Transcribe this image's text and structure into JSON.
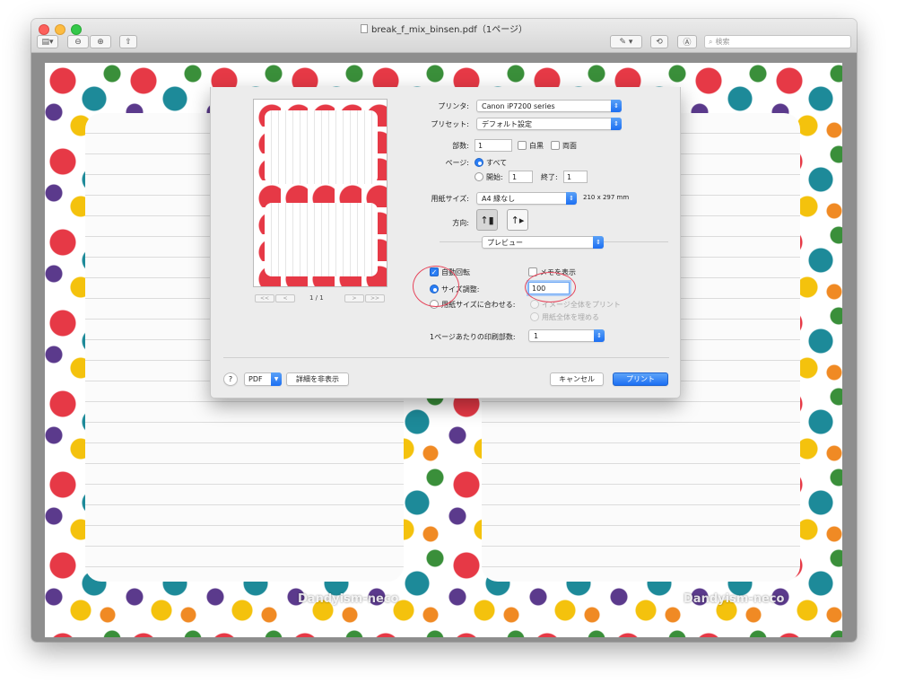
{
  "window": {
    "title": "break_f_mix_binsen.pdf（1ページ）",
    "search_placeholder": "検索"
  },
  "toolbar": {
    "sidebar_icon": "sidebar-icon",
    "zoom_out_icon": "zoom-out-icon",
    "zoom_in_icon": "zoom-in-icon",
    "share_icon": "share-icon",
    "markup_icon": "pen-icon",
    "rotate_icon": "rotate-icon",
    "annotate_icon": "annotate-icon"
  },
  "document": {
    "watermark": "Dandyism-neco"
  },
  "print": {
    "printer_label": "プリンタ:",
    "printer_value": "Canon iP7200 series",
    "preset_label": "プリセット:",
    "preset_value": "デフォルト設定",
    "copies_label": "部数:",
    "copies_value": "1",
    "bw_label": "白黒",
    "duplex_label": "両面",
    "pages_label": "ページ:",
    "pages_all": "すべて",
    "pages_from_label": "開始:",
    "pages_from_value": "1",
    "pages_to_label": "終了:",
    "pages_to_value": "1",
    "paper_label": "用紙サイズ:",
    "paper_value": "A4 縁なし",
    "paper_dims": "210 x 297 mm",
    "orientation_label": "方向:",
    "section_value": "プレビュー",
    "auto_rotate_label": "自動回転",
    "show_notes_label": "メモを表示",
    "scale_label": "サイズ調整:",
    "scale_value": "100",
    "fit_label": "用紙サイズに合わせる:",
    "print_entire_label": "イメージ全体をプリント",
    "fill_paper_label": "用紙全体を埋める",
    "pages_per_sheet_label": "1ページあたりの印刷部数:",
    "pages_per_sheet_value": "1",
    "page_indicator": "1 / 1",
    "help_label": "?",
    "pdf_label": "PDF",
    "hide_details_label": "詳細を非表示",
    "cancel_label": "キャンセル",
    "print_label": "プリント",
    "pager_first": "<<",
    "pager_prev": "<",
    "pager_next": ">",
    "pager_last": ">>"
  },
  "colors": {
    "accent": "#2a7ef5",
    "annotation": "#e6445a"
  }
}
